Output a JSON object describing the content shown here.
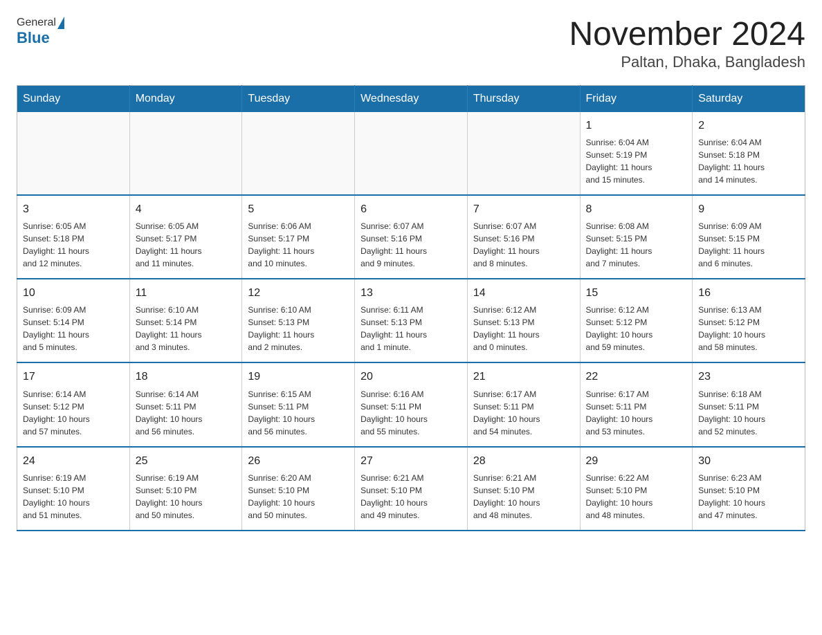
{
  "header": {
    "logo_general": "General",
    "logo_blue": "Blue",
    "title": "November 2024",
    "subtitle": "Paltan, Dhaka, Bangladesh"
  },
  "weekdays": [
    "Sunday",
    "Monday",
    "Tuesday",
    "Wednesday",
    "Thursday",
    "Friday",
    "Saturday"
  ],
  "weeks": [
    [
      {
        "day": "",
        "info": ""
      },
      {
        "day": "",
        "info": ""
      },
      {
        "day": "",
        "info": ""
      },
      {
        "day": "",
        "info": ""
      },
      {
        "day": "",
        "info": ""
      },
      {
        "day": "1",
        "info": "Sunrise: 6:04 AM\nSunset: 5:19 PM\nDaylight: 11 hours\nand 15 minutes."
      },
      {
        "day": "2",
        "info": "Sunrise: 6:04 AM\nSunset: 5:18 PM\nDaylight: 11 hours\nand 14 minutes."
      }
    ],
    [
      {
        "day": "3",
        "info": "Sunrise: 6:05 AM\nSunset: 5:18 PM\nDaylight: 11 hours\nand 12 minutes."
      },
      {
        "day": "4",
        "info": "Sunrise: 6:05 AM\nSunset: 5:17 PM\nDaylight: 11 hours\nand 11 minutes."
      },
      {
        "day": "5",
        "info": "Sunrise: 6:06 AM\nSunset: 5:17 PM\nDaylight: 11 hours\nand 10 minutes."
      },
      {
        "day": "6",
        "info": "Sunrise: 6:07 AM\nSunset: 5:16 PM\nDaylight: 11 hours\nand 9 minutes."
      },
      {
        "day": "7",
        "info": "Sunrise: 6:07 AM\nSunset: 5:16 PM\nDaylight: 11 hours\nand 8 minutes."
      },
      {
        "day": "8",
        "info": "Sunrise: 6:08 AM\nSunset: 5:15 PM\nDaylight: 11 hours\nand 7 minutes."
      },
      {
        "day": "9",
        "info": "Sunrise: 6:09 AM\nSunset: 5:15 PM\nDaylight: 11 hours\nand 6 minutes."
      }
    ],
    [
      {
        "day": "10",
        "info": "Sunrise: 6:09 AM\nSunset: 5:14 PM\nDaylight: 11 hours\nand 5 minutes."
      },
      {
        "day": "11",
        "info": "Sunrise: 6:10 AM\nSunset: 5:14 PM\nDaylight: 11 hours\nand 3 minutes."
      },
      {
        "day": "12",
        "info": "Sunrise: 6:10 AM\nSunset: 5:13 PM\nDaylight: 11 hours\nand 2 minutes."
      },
      {
        "day": "13",
        "info": "Sunrise: 6:11 AM\nSunset: 5:13 PM\nDaylight: 11 hours\nand 1 minute."
      },
      {
        "day": "14",
        "info": "Sunrise: 6:12 AM\nSunset: 5:13 PM\nDaylight: 11 hours\nand 0 minutes."
      },
      {
        "day": "15",
        "info": "Sunrise: 6:12 AM\nSunset: 5:12 PM\nDaylight: 10 hours\nand 59 minutes."
      },
      {
        "day": "16",
        "info": "Sunrise: 6:13 AM\nSunset: 5:12 PM\nDaylight: 10 hours\nand 58 minutes."
      }
    ],
    [
      {
        "day": "17",
        "info": "Sunrise: 6:14 AM\nSunset: 5:12 PM\nDaylight: 10 hours\nand 57 minutes."
      },
      {
        "day": "18",
        "info": "Sunrise: 6:14 AM\nSunset: 5:11 PM\nDaylight: 10 hours\nand 56 minutes."
      },
      {
        "day": "19",
        "info": "Sunrise: 6:15 AM\nSunset: 5:11 PM\nDaylight: 10 hours\nand 56 minutes."
      },
      {
        "day": "20",
        "info": "Sunrise: 6:16 AM\nSunset: 5:11 PM\nDaylight: 10 hours\nand 55 minutes."
      },
      {
        "day": "21",
        "info": "Sunrise: 6:17 AM\nSunset: 5:11 PM\nDaylight: 10 hours\nand 54 minutes."
      },
      {
        "day": "22",
        "info": "Sunrise: 6:17 AM\nSunset: 5:11 PM\nDaylight: 10 hours\nand 53 minutes."
      },
      {
        "day": "23",
        "info": "Sunrise: 6:18 AM\nSunset: 5:11 PM\nDaylight: 10 hours\nand 52 minutes."
      }
    ],
    [
      {
        "day": "24",
        "info": "Sunrise: 6:19 AM\nSunset: 5:10 PM\nDaylight: 10 hours\nand 51 minutes."
      },
      {
        "day": "25",
        "info": "Sunrise: 6:19 AM\nSunset: 5:10 PM\nDaylight: 10 hours\nand 50 minutes."
      },
      {
        "day": "26",
        "info": "Sunrise: 6:20 AM\nSunset: 5:10 PM\nDaylight: 10 hours\nand 50 minutes."
      },
      {
        "day": "27",
        "info": "Sunrise: 6:21 AM\nSunset: 5:10 PM\nDaylight: 10 hours\nand 49 minutes."
      },
      {
        "day": "28",
        "info": "Sunrise: 6:21 AM\nSunset: 5:10 PM\nDaylight: 10 hours\nand 48 minutes."
      },
      {
        "day": "29",
        "info": "Sunrise: 6:22 AM\nSunset: 5:10 PM\nDaylight: 10 hours\nand 48 minutes."
      },
      {
        "day": "30",
        "info": "Sunrise: 6:23 AM\nSunset: 5:10 PM\nDaylight: 10 hours\nand 47 minutes."
      }
    ]
  ]
}
